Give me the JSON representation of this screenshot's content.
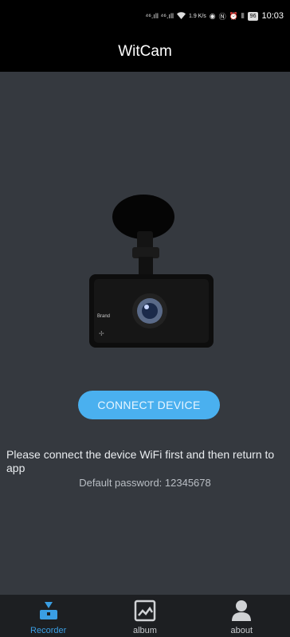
{
  "status_bar": {
    "network": "⁴⁶.ıll ⁴⁶.ıll",
    "speed": "1.9 K/s",
    "battery": "96",
    "time": "10:03"
  },
  "app": {
    "title": "WitCam"
  },
  "camera": {
    "brand_label": "Brand"
  },
  "main": {
    "connect_button": "CONNECT DEVICE",
    "instruction": "Please connect the device WiFi first and then return to app",
    "password": "Default password: 12345678"
  },
  "nav": {
    "items": [
      {
        "label": "Recorder",
        "icon": "recorder-icon",
        "active": true
      },
      {
        "label": "album",
        "icon": "album-icon",
        "active": false
      },
      {
        "label": "about",
        "icon": "person-icon",
        "active": false
      }
    ]
  },
  "colors": {
    "accent": "#4ab0ef",
    "background": "#35393f",
    "nav_active": "#3a9ee4"
  }
}
